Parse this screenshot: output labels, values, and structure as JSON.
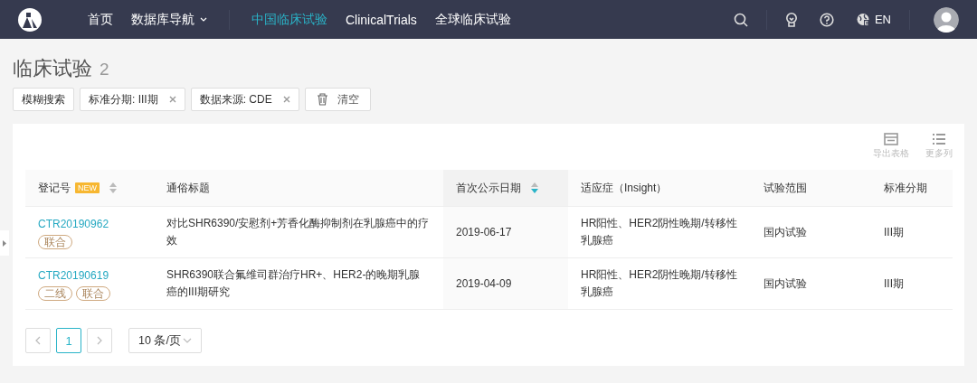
{
  "header": {
    "nav": [
      {
        "label": "首页",
        "selected": false
      },
      {
        "label": "数据库导航",
        "selected": false,
        "has_menu": true
      },
      {
        "label": "中国临床试验",
        "selected": true
      },
      {
        "label": "ClinicalTrials",
        "selected": false
      },
      {
        "label": "全球临床试验",
        "selected": false
      }
    ],
    "language": "EN"
  },
  "page": {
    "title": "临床试验",
    "count": "2"
  },
  "filters": [
    {
      "kind": "search",
      "label": "模糊搜索"
    },
    {
      "kind": "tag",
      "label": "标准分期: III期"
    },
    {
      "kind": "tag",
      "label": "数据来源: CDE"
    },
    {
      "kind": "clear",
      "label": "清空"
    }
  ],
  "toolbar": [
    {
      "kind": "export",
      "label": "导出表格"
    },
    {
      "kind": "columns",
      "label": "更多列"
    }
  ],
  "table": {
    "columns": [
      {
        "label": "登记号",
        "badge": "NEW",
        "sortable": true,
        "sorted": false
      },
      {
        "label": "通俗标题"
      },
      {
        "label": "首次公示日期",
        "sortable": true,
        "sorted": true
      },
      {
        "label": "适应症（Insight）"
      },
      {
        "label": "试验范围"
      },
      {
        "label": "标准分期"
      }
    ],
    "rows": [
      {
        "id": "CTR20190962",
        "tags": [
          "联合"
        ],
        "title": "对比SHR6390/安慰剂+芳香化酶抑制剂在乳腺癌中的疗效",
        "date": "2019-06-17",
        "indication": "HR阳性、HER2阴性晚期/转移性乳腺癌",
        "scope": "国内试验",
        "phase": "III期"
      },
      {
        "id": "CTR20190619",
        "tags": [
          "二线",
          "联合"
        ],
        "title": "SHR6390联合氟维司群治疗HR+、HER2-的晚期乳腺癌的III期研究",
        "date": "2019-04-09",
        "indication": "HR阳性、HER2阴性晚期/转移性乳腺癌",
        "scope": "国内试验",
        "phase": "III期"
      }
    ]
  },
  "pagination": {
    "pages": [
      {
        "label": "1",
        "selected": true
      }
    ],
    "page_size": "10 条/页"
  }
}
